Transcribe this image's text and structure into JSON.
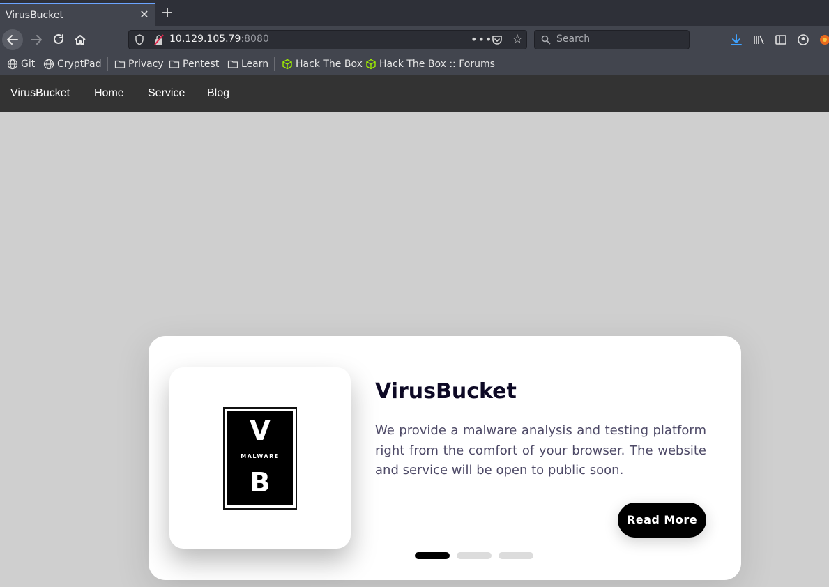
{
  "browser": {
    "tab_title": "VirusBucket",
    "url_host": "10.129.105.79",
    "url_port": ":8080",
    "url_menu": "•••",
    "search_placeholder": "Search",
    "bookmarks": [
      {
        "label": "Git",
        "icon": "globe-icon"
      },
      {
        "label": "CryptPad",
        "icon": "globe-icon"
      },
      {
        "label": "Privacy",
        "icon": "folder-icon"
      },
      {
        "label": "Pentest",
        "icon": "folder-icon"
      },
      {
        "label": "Learn",
        "icon": "folder-icon"
      },
      {
        "label": "Hack The Box",
        "icon": "htb-cube-icon"
      },
      {
        "label": "Hack The Box :: Forums",
        "icon": "htb-cube-icon"
      }
    ],
    "accent_color": "#6ba4ff"
  },
  "site": {
    "brand": "VirusBucket",
    "nav": [
      "Home",
      "Service",
      "Blog"
    ]
  },
  "hero": {
    "title": "VirusBucket",
    "text": "We provide a malware analysis and testing platform right from the comfort of your browser. The website and service will be open to public soon.",
    "button": "Read More",
    "logo": {
      "top": "V",
      "middle": "MALWARE",
      "bottom": "B"
    },
    "slides": 3,
    "active_slide": 1
  }
}
